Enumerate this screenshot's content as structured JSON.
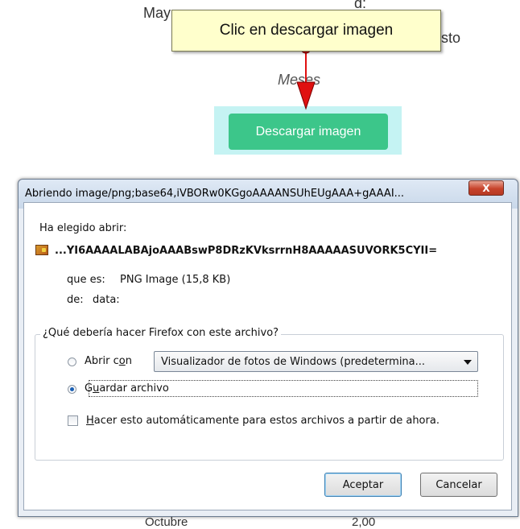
{
  "background": {
    "partial_text_left": "May",
    "partial_text_top_right": "d:",
    "partial_text_right": "sto",
    "axis_label": "Meses",
    "callout_text": "Clic en descargar imagen",
    "download_button_label": "Descargar imagen",
    "bottom_text_left": "Octubre",
    "bottom_text_right": "2,00"
  },
  "dialog": {
    "title": "Abriendo image/png;base64,iVBORw0KGgoAAAANSUhEUgAAA+gAAAI...",
    "close_label": "X",
    "chosen_open_label": "Ha elegido abrir:",
    "file_name": "...YI6AAAALABAjoAAABswP8DRzKVksrrnH8AAAAASUVORK5CYII=",
    "type_label": "que es:",
    "type_value": "PNG Image (15,8 KB)",
    "from_label": "de:",
    "from_value": "data:",
    "question": "¿Qué debería hacer Firefox con este archivo?",
    "open_with_pre": "Abrir c",
    "open_with_mnemonic": "o",
    "open_with_post": "n",
    "open_with_app": "Visualizador de fotos de Windows (predetermina...",
    "save_pre": "G",
    "save_mnemonic": "u",
    "save_post": "ardar archivo",
    "auto_mnemonic": "H",
    "auto_post": "acer esto automáticamente para estos archivos a partir de ahora.",
    "ok_label": "Aceptar",
    "cancel_label": "Cancelar"
  },
  "colors": {
    "callout_bg": "#ffffcc",
    "highlight_bg": "#c5f3f3",
    "download_button_bg": "#3cc68a",
    "arrow": "#e01010"
  }
}
